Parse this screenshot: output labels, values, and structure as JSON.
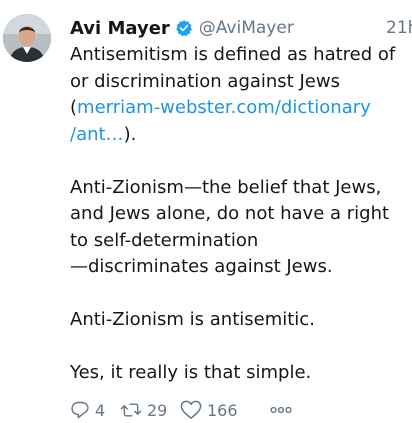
{
  "tweet": {
    "display_name": "Avi Mayer",
    "handle": "@AviMayer",
    "time": "21h",
    "body": {
      "line1": "Antisemitism is defined as hatred of",
      "line2": "or discrimination against Jews",
      "line3_open": "(",
      "link_part1": "merriam-webster.com/dictionary",
      "link_part2": "/ant…",
      "line4_close": ").",
      "para2_line1": "Anti-Zionism—the belief that Jews,",
      "para2_line2": "and Jews alone, do not have a right",
      "para2_line3": "to self-determination",
      "para2_line4": "—discriminates against Jews.",
      "para3": "Anti-Zionism is antisemitic.",
      "para4": "Yes, it really is that simple."
    },
    "actions": {
      "reply_count": "4",
      "retweet_count": "29",
      "like_count": "166"
    },
    "icons": {
      "verified": "verified-badge-icon",
      "reply": "reply-icon",
      "retweet": "retweet-icon",
      "like": "heart-icon",
      "more": "more-icon"
    },
    "colors": {
      "link": "#1b95e0",
      "verified": "#1da1f2",
      "muted": "#657786",
      "text": "#14171a"
    }
  }
}
